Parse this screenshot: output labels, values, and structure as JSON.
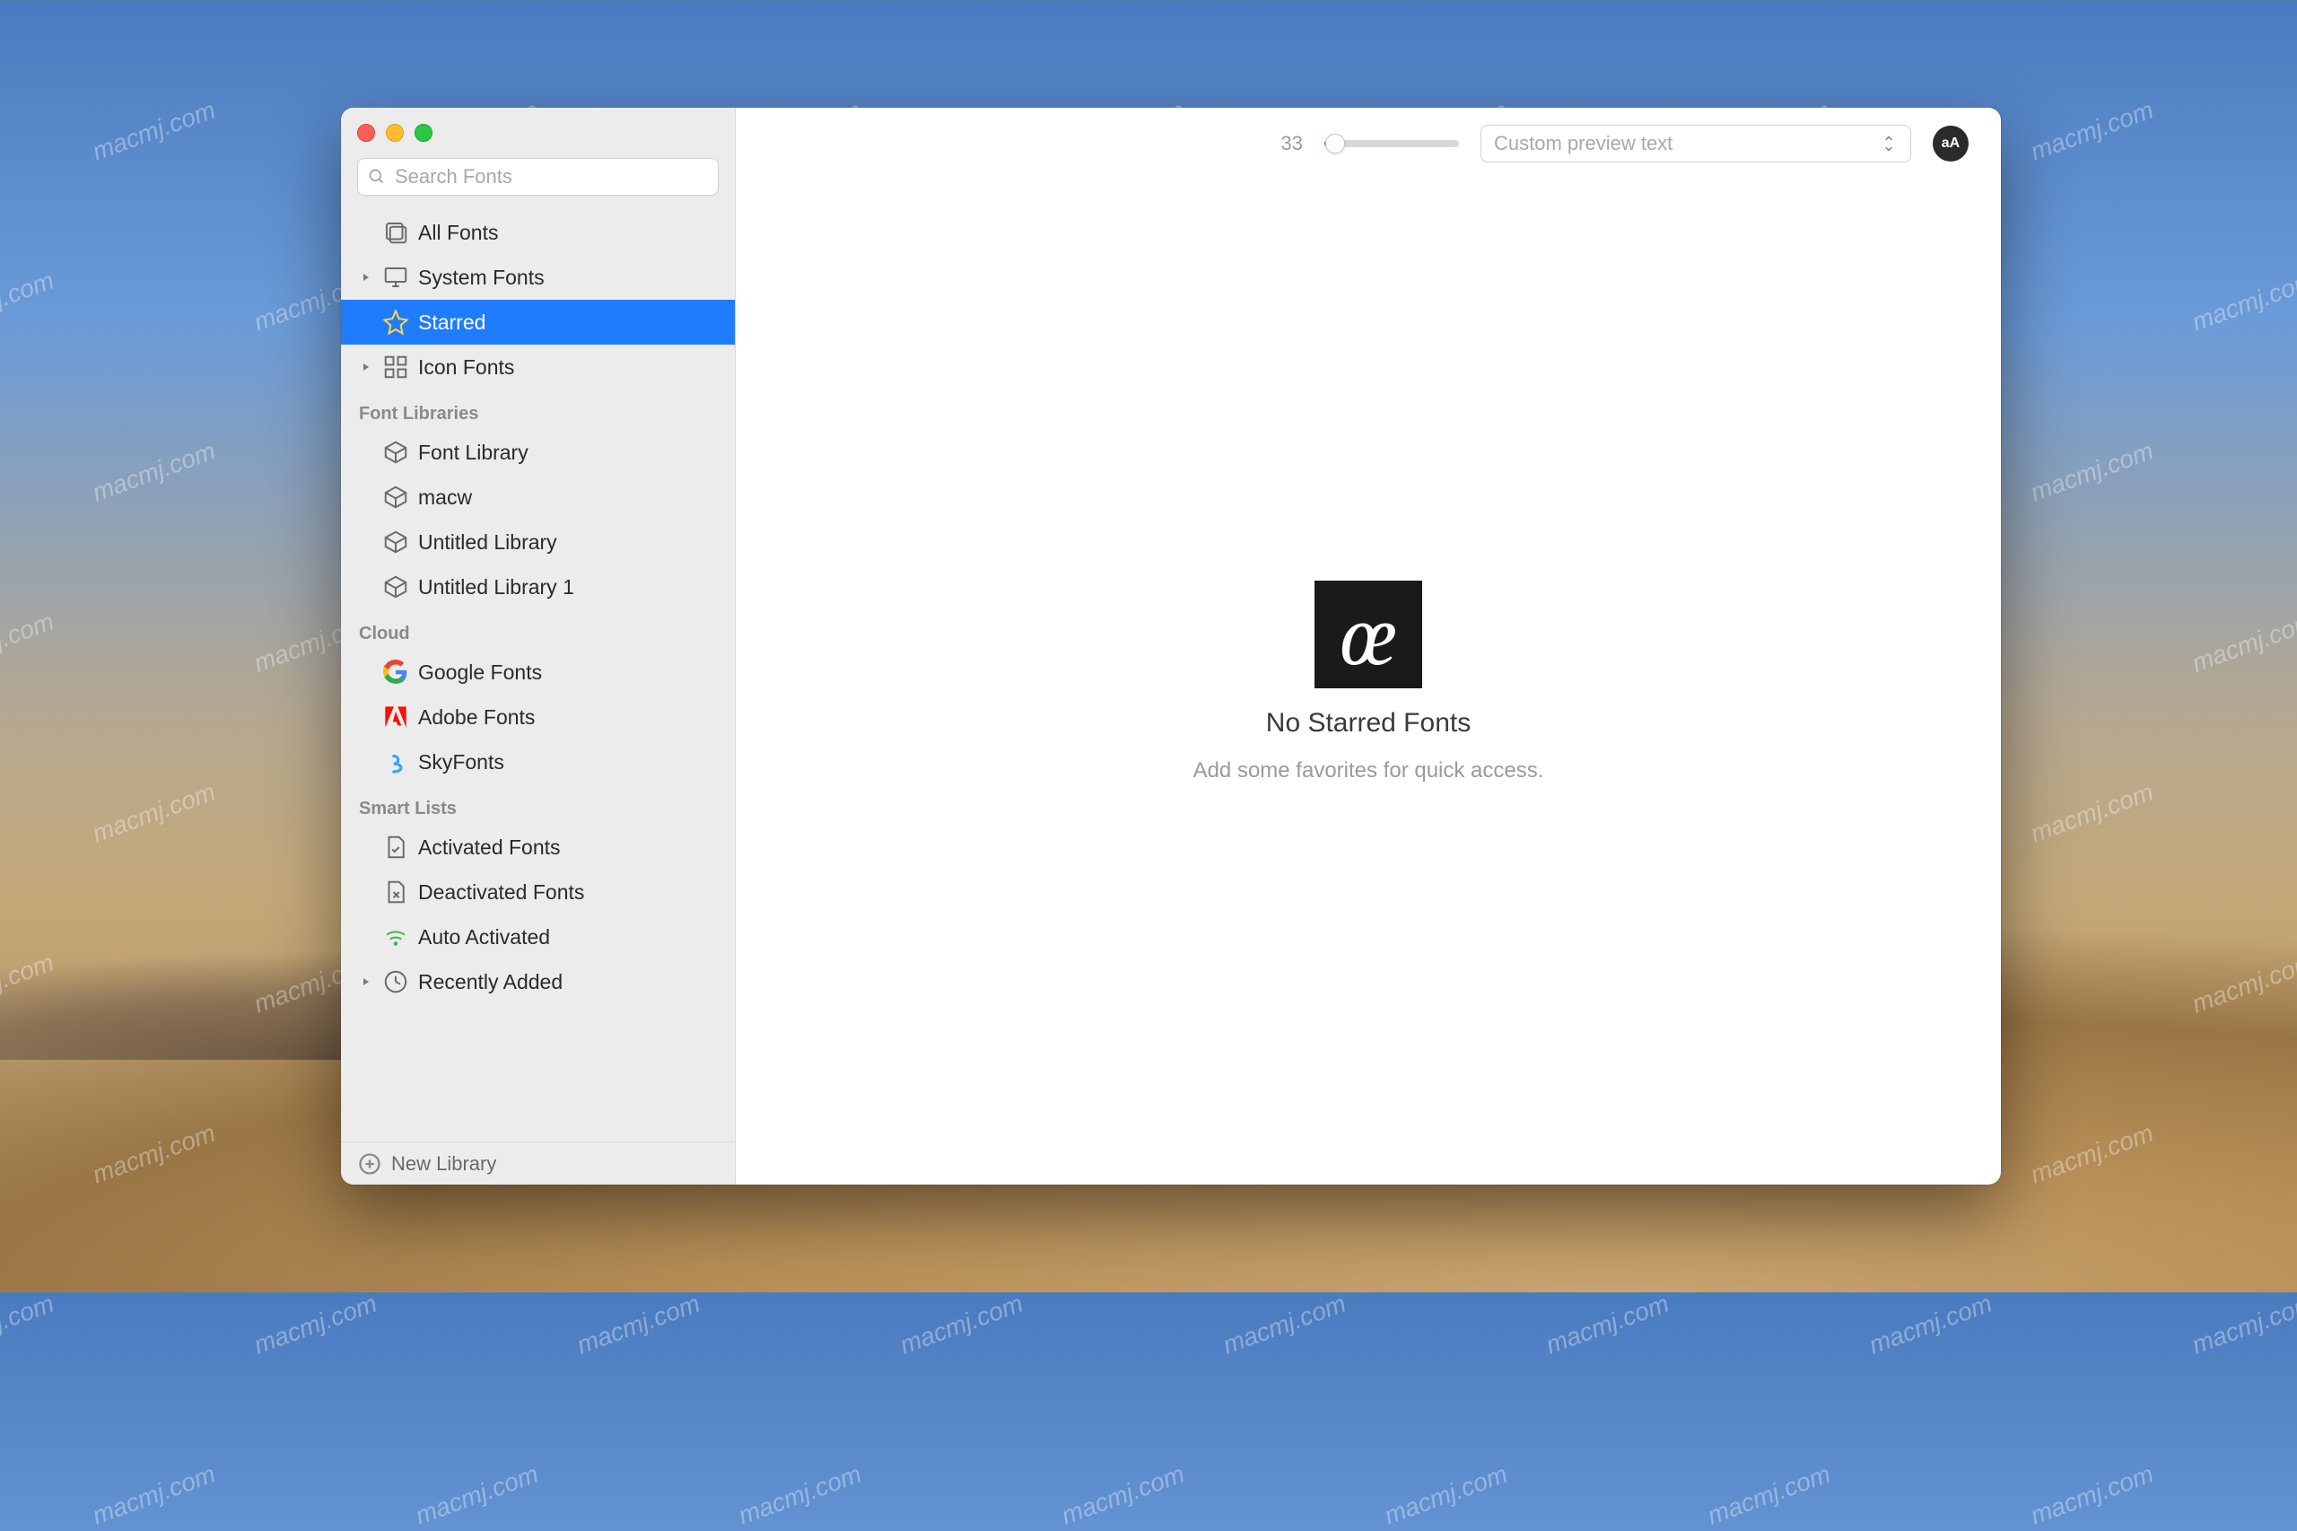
{
  "watermark": "macmj.com",
  "search": {
    "placeholder": "Search Fonts"
  },
  "sidebar": {
    "main": [
      {
        "label": "All Fonts",
        "icon": "stack-icon",
        "expandable": false
      },
      {
        "label": "System Fonts",
        "icon": "monitor-icon",
        "expandable": true
      },
      {
        "label": "Starred",
        "icon": "star-icon",
        "expandable": false,
        "selected": true
      },
      {
        "label": "Icon Fonts",
        "icon": "grid-icon",
        "expandable": true
      }
    ],
    "sections": {
      "libraries": {
        "title": "Font Libraries",
        "items": [
          {
            "label": "Font Library",
            "icon": "box-icon"
          },
          {
            "label": "macw",
            "icon": "box-icon"
          },
          {
            "label": "Untitled Library",
            "icon": "box-icon"
          },
          {
            "label": "Untitled Library 1",
            "icon": "box-icon"
          }
        ]
      },
      "cloud": {
        "title": "Cloud",
        "items": [
          {
            "label": "Google Fonts",
            "icon": "google-icon"
          },
          {
            "label": "Adobe Fonts",
            "icon": "adobe-icon"
          },
          {
            "label": "SkyFonts",
            "icon": "skyfonts-icon"
          }
        ]
      },
      "smart": {
        "title": "Smart Lists",
        "items": [
          {
            "label": "Activated Fonts",
            "icon": "page-check-icon"
          },
          {
            "label": "Deactivated Fonts",
            "icon": "page-x-icon"
          },
          {
            "label": "Auto Activated",
            "icon": "wifi-icon"
          },
          {
            "label": "Recently Added",
            "icon": "clock-icon",
            "expandable": true
          }
        ]
      }
    },
    "footer": {
      "label": "New Library"
    }
  },
  "toolbar": {
    "size_value": "33",
    "preview_placeholder": "Custom preview text",
    "round_label": "aA"
  },
  "empty": {
    "glyph": "œ",
    "title": "No Starred Fonts",
    "subtitle": "Add some favorites for quick access."
  }
}
